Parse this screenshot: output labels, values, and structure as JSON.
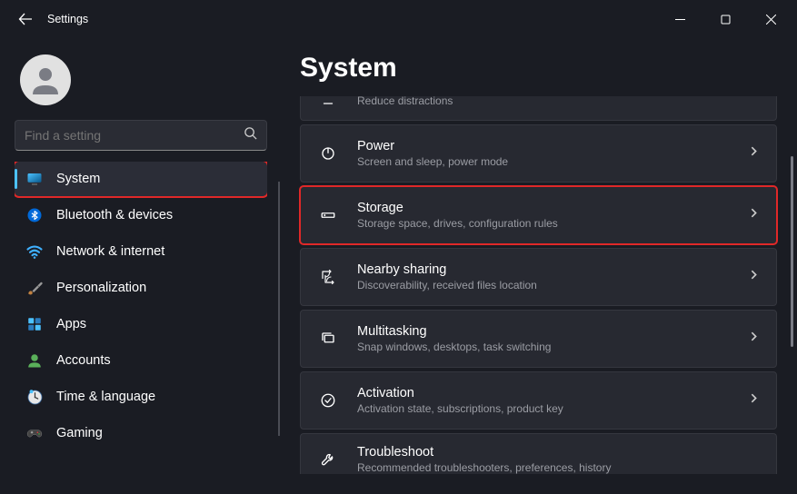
{
  "window": {
    "title": "Settings"
  },
  "search": {
    "placeholder": "Find a setting"
  },
  "sidebar": {
    "items": [
      {
        "label": "System",
        "icon": "monitor",
        "selected": true,
        "highlight": true
      },
      {
        "label": "Bluetooth & devices",
        "icon": "bluetooth"
      },
      {
        "label": "Network & internet",
        "icon": "wifi"
      },
      {
        "label": "Personalization",
        "icon": "brush"
      },
      {
        "label": "Apps",
        "icon": "apps"
      },
      {
        "label": "Accounts",
        "icon": "person"
      },
      {
        "label": "Time & language",
        "icon": "clock"
      },
      {
        "label": "Gaming",
        "icon": "gamepad"
      }
    ]
  },
  "page": {
    "title": "System"
  },
  "settings": [
    {
      "title": "",
      "desc": "Reduce distractions",
      "icon": "minus",
      "partial": "top"
    },
    {
      "title": "Power",
      "desc": "Screen and sleep, power mode",
      "icon": "power"
    },
    {
      "title": "Storage",
      "desc": "Storage space, drives, configuration rules",
      "icon": "drive",
      "highlight": true
    },
    {
      "title": "Nearby sharing",
      "desc": "Discoverability, received files location",
      "icon": "share"
    },
    {
      "title": "Multitasking",
      "desc": "Snap windows, desktops, task switching",
      "icon": "multitask"
    },
    {
      "title": "Activation",
      "desc": "Activation state, subscriptions, product key",
      "icon": "check"
    },
    {
      "title": "Troubleshoot",
      "desc": "Recommended troubleshooters, preferences, history",
      "icon": "wrench",
      "partial": "bottom"
    }
  ]
}
